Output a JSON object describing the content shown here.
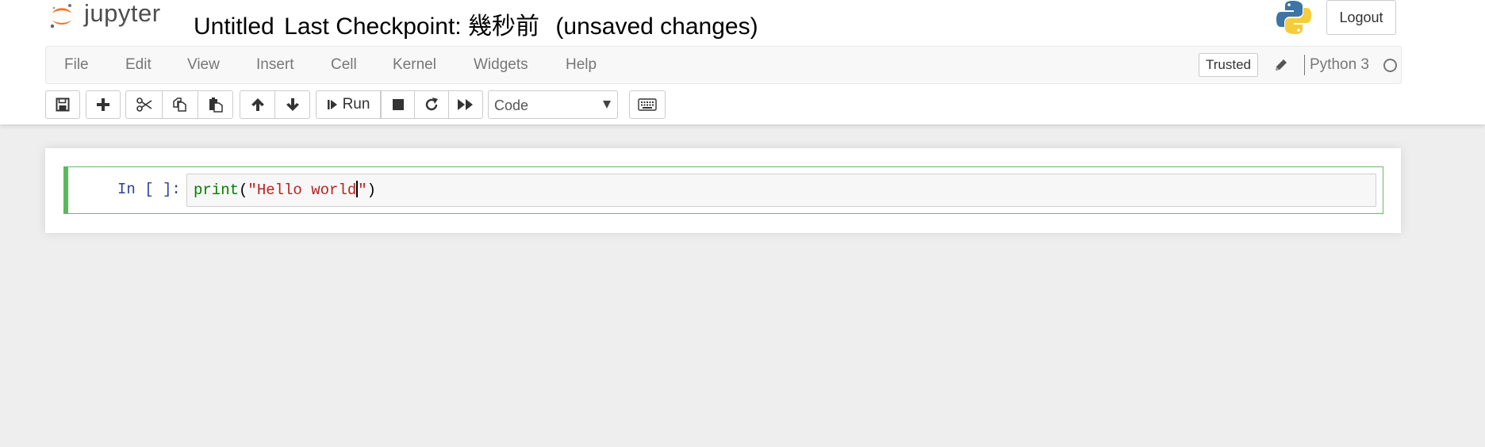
{
  "header": {
    "logo_text": "jupyter",
    "notebook_name": "Untitled",
    "checkpoint": "Last Checkpoint: 幾秒前",
    "autosave_status": "(unsaved changes)",
    "logout_label": "Logout"
  },
  "menubar": {
    "items": [
      "File",
      "Edit",
      "View",
      "Insert",
      "Cell",
      "Kernel",
      "Widgets",
      "Help"
    ],
    "trusted_label": "Trusted",
    "kernel_name": "Python 3"
  },
  "toolbar": {
    "run_label": "Run",
    "cell_type": "Code",
    "buttons": [
      "save",
      "insert-cell-below",
      "cut",
      "copy",
      "paste",
      "move-up",
      "move-down",
      "run",
      "interrupt",
      "restart",
      "restart-run-all",
      "command-palette"
    ]
  },
  "cells": [
    {
      "prompt": "In [ ]:",
      "code_func": "print",
      "code_open": "(",
      "code_string_before_cursor": "\"Hello world",
      "code_string_after_cursor": "\"",
      "code_close": ")"
    }
  ],
  "colors": {
    "active_cell_border": "#5cb85c",
    "prompt": "#303f9f",
    "keyword": "#008000",
    "string": "#ba2121",
    "background": "#eeeeee"
  }
}
